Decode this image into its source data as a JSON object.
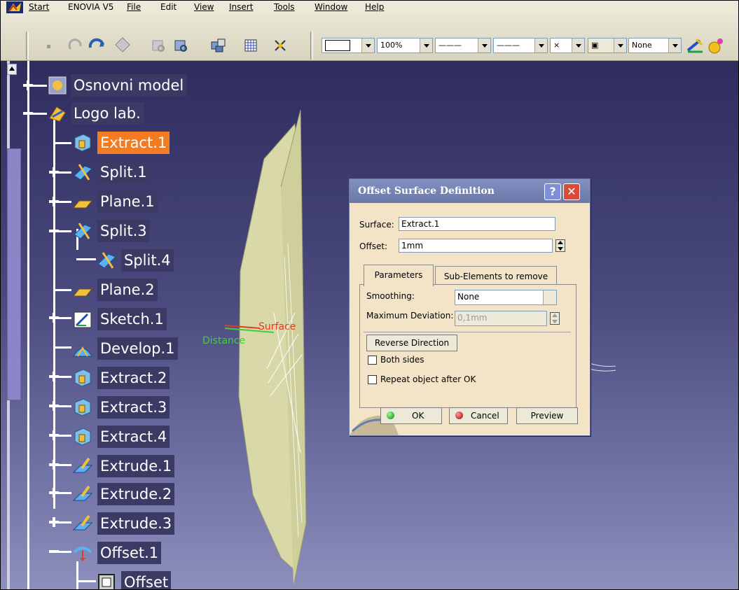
{
  "menu": {
    "items": [
      "Start",
      "ENOVIA V5",
      "File",
      "Edit",
      "View",
      "Insert",
      "Tools",
      "Window",
      "Help"
    ]
  },
  "toolbar": {
    "line_color_combo": "",
    "zoom_combo": "100%",
    "linetype_combo": "———",
    "lineweight_combo": "———",
    "point_combo": "×",
    "layer_combo": "None"
  },
  "tree": {
    "nodes": [
      {
        "label": "Osnovni model",
        "icon": "assembly-icon"
      },
      {
        "label": "Logo lab.",
        "icon": "body-icon"
      },
      {
        "label": "Extract.1",
        "icon": "extract-icon",
        "selected": true
      },
      {
        "label": "Split.1",
        "icon": "split-icon"
      },
      {
        "label": "Plane.1",
        "icon": "plane-icon"
      },
      {
        "label": "Split.3",
        "icon": "split-icon"
      },
      {
        "label": "Split.4",
        "icon": "split-icon"
      },
      {
        "label": "Plane.2",
        "icon": "plane-icon"
      },
      {
        "label": "Sketch.1",
        "icon": "sketch-icon"
      },
      {
        "label": "Develop.1",
        "icon": "develop-icon"
      },
      {
        "label": "Extract.2",
        "icon": "extract-icon"
      },
      {
        "label": "Extract.3",
        "icon": "extract-icon"
      },
      {
        "label": "Extract.4",
        "icon": "extract-icon"
      },
      {
        "label": "Extrude.1",
        "icon": "extrude-icon"
      },
      {
        "label": "Extrude.2",
        "icon": "extrude-icon"
      },
      {
        "label": "Extrude.3",
        "icon": "extrude-icon"
      },
      {
        "label": "Offset.1",
        "icon": "offset-icon"
      },
      {
        "label": "Offset",
        "icon": "parameter-icon"
      }
    ]
  },
  "viewport": {
    "label_distance": "Distance",
    "label_surface": "Surface",
    "colors": {
      "distance": "#3cd23c",
      "surface": "#e03c1e"
    }
  },
  "dialog": {
    "title": "Offset Surface Definition",
    "surface_label": "Surface:",
    "surface_value": "Extract.1",
    "offset_label": "Offset:",
    "offset_value": "1mm",
    "tabs": [
      "Parameters",
      "Sub-Elements to remove"
    ],
    "smoothing_label": "Smoothing:",
    "smoothing_value": "None",
    "max_dev_label": "Maximum Deviation:",
    "max_dev_value": "0,1mm",
    "reverse_button": "Reverse Direction",
    "both_sides_label": "Both sides",
    "repeat_label": "Repeat object after OK",
    "ok_button": "OK",
    "cancel_button": "Cancel",
    "preview_button": "Preview"
  }
}
